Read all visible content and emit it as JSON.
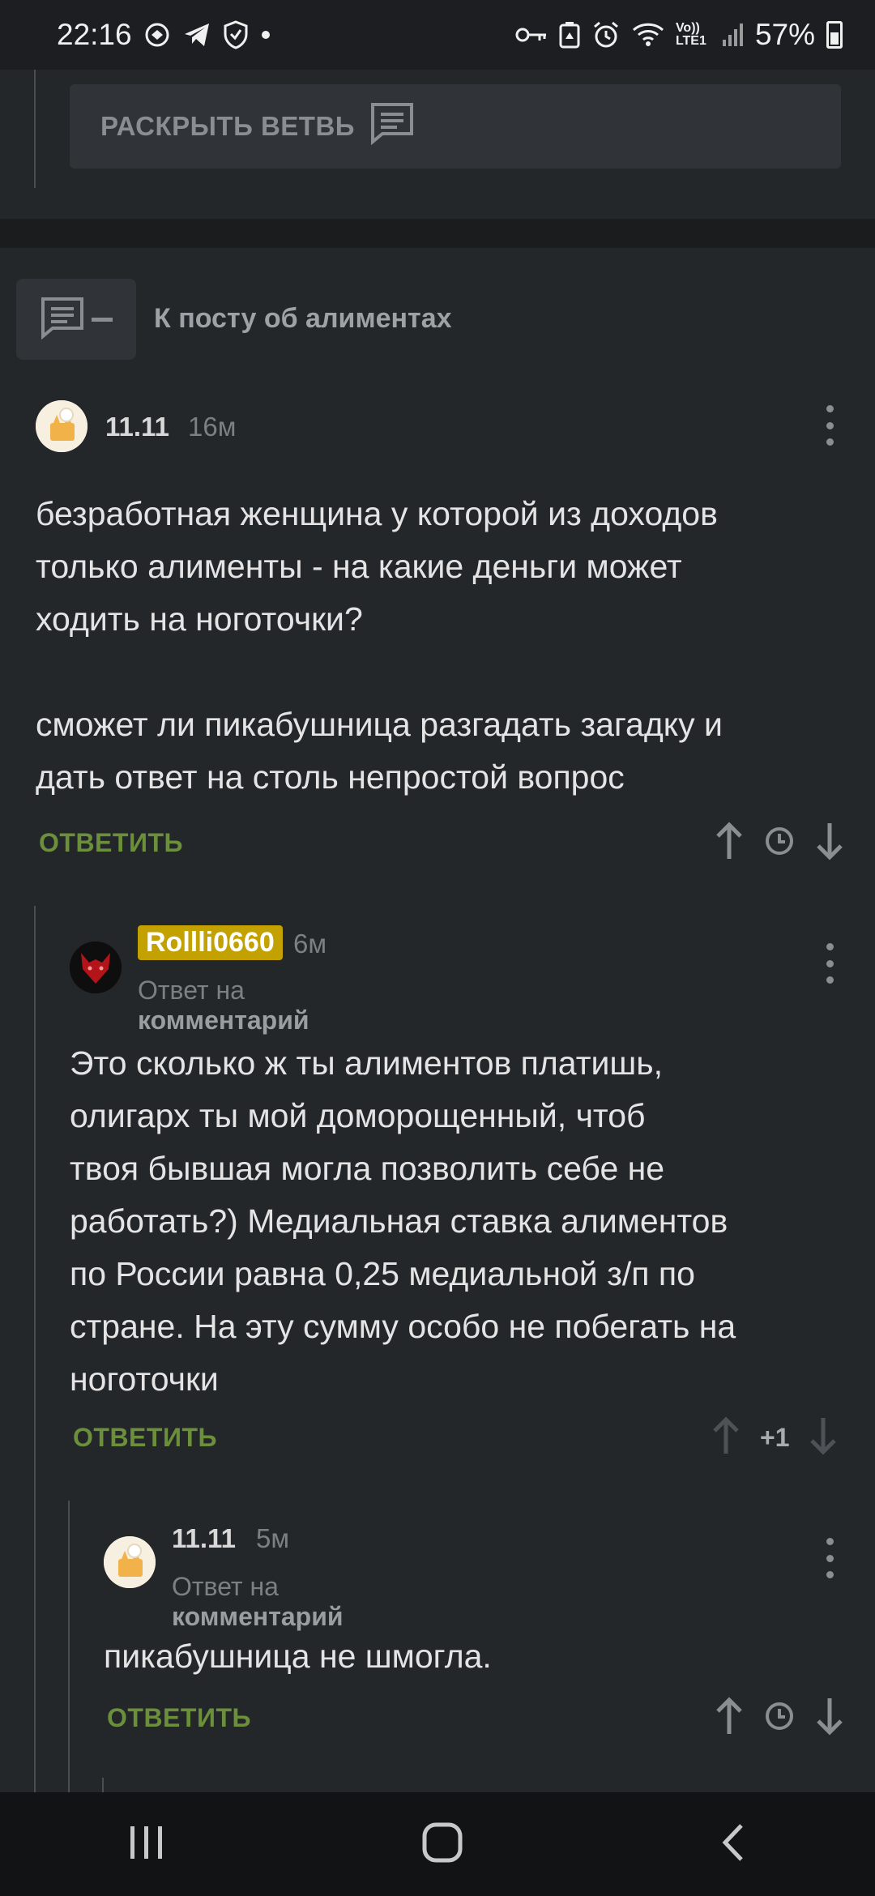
{
  "status_bar": {
    "time": "22:16",
    "network": "Vo)) LTE1",
    "battery_percent": "57%",
    "icons": [
      "whatsapp-like-icon",
      "telegram-icon",
      "vpn-shield-icon",
      "dot-icon",
      "key-icon",
      "recycle-battery-icon",
      "alarm-icon",
      "wifi-icon",
      "signal-icon",
      "battery-icon"
    ]
  },
  "thread_top": {
    "expand_label": "РАСКРЫТЬ ВЕТВЬ"
  },
  "to_post": {
    "label": "К посту об алиментах"
  },
  "comments": [
    {
      "author": "11.11",
      "time": "16м",
      "text": "безработная женщина у которой из доходов\nтолько алименты - на какие деньги может\nходить на ноготочки?\n\nсможет ли пикабушница разгадать загадку и\nдать ответ на столь непростой вопрос",
      "reply_label": "ОТВЕТИТЬ"
    },
    {
      "author": "Rollli0660",
      "time": "6м",
      "reply_to_prefix": "Ответ на",
      "reply_to_target": "комментарий",
      "text": "Это сколько ж ты алиментов платишь,\nолигарх ты мой доморощенный, чтоб\nтвоя бывшая могла позволить себе не\nработать?) Медиальная ставка алиментов\nпо России равна 0,25 медиальной з/п по\nстране. На эту сумму особо не побегать на\nноготочки",
      "reply_label": "ОТВЕТИТЬ",
      "rating": "+1"
    },
    {
      "author": "11.11",
      "time": "5м",
      "reply_to_prefix": "Ответ на",
      "reply_to_target": "комментарий",
      "text": "пикабушница не шмогла.",
      "reply_label": "ОТВЕТИТЬ"
    }
  ],
  "nav": {
    "buttons": [
      "recents-icon",
      "home-icon",
      "back-icon"
    ]
  },
  "colors": {
    "background": "#24272a",
    "accent_reply": "#6b8f3a",
    "badge": "#c2a100"
  }
}
